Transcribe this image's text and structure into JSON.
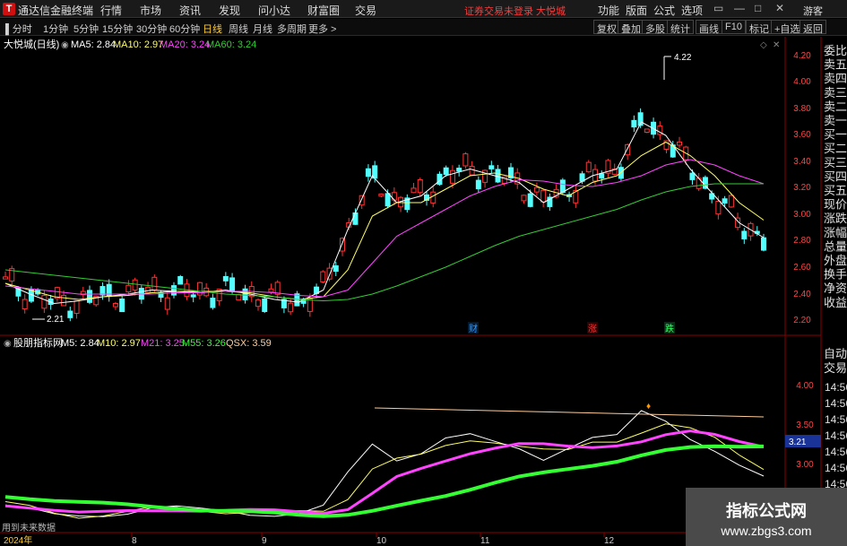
{
  "app": {
    "title": "通达信金融终端",
    "menu": [
      "行情",
      "市场",
      "资讯",
      "发现",
      "问小达",
      "财富圈",
      "交易"
    ],
    "notice": "证券交易未登录  大悦城",
    "right_menu": [
      "功能",
      "版面",
      "公式",
      "选项"
    ],
    "guest": "游客"
  },
  "toolbar": {
    "periods": [
      "分时",
      "1分钟",
      "5分钟",
      "15分钟",
      "30分钟",
      "60分钟",
      "日线",
      "周线",
      "月线",
      "多周期",
      "更多 >"
    ],
    "active_period": "日线",
    "buttons": [
      "复权",
      "叠加",
      "多股",
      "统计",
      "画线",
      "F10",
      "标记",
      "+自选",
      "返回"
    ]
  },
  "main_chart": {
    "stock_label": "大悦城(日线)",
    "ma_legend": [
      {
        "label": "MA5: 2.84",
        "color": "#ffffff"
      },
      {
        "label": "MA10: 2.97",
        "color": "#ffff66"
      },
      {
        "label": "MA20: 3.24",
        "color": "#ff44ff"
      },
      {
        "label": "MA60: 3.24",
        "color": "#33cc33"
      }
    ],
    "price_axis": [
      "4.20",
      "4.00",
      "3.80",
      "3.60",
      "3.40",
      "3.20",
      "3.00",
      "2.80",
      "2.60",
      "2.40",
      "2.20"
    ],
    "high_label": "4.22",
    "low_label": "2.21",
    "event_markers": [
      {
        "label": "财",
        "color": "#3399ff"
      },
      {
        "label": "涨",
        "color": "#ff3333"
      },
      {
        "label": "跌",
        "color": "#33ff66"
      }
    ]
  },
  "side_panel": {
    "labels": [
      "委比",
      "卖五",
      "卖四",
      "卖三",
      "卖二",
      "卖一",
      "买一",
      "买二",
      "买三",
      "买四",
      "买五",
      "现价",
      "涨跌",
      "涨幅",
      "总量",
      "外盘",
      "换手",
      "净资",
      "收益"
    ],
    "lower_labels": [
      "自动",
      "交易"
    ],
    "times": [
      "14:56",
      "14:56",
      "14:56",
      "14:56",
      "14:56",
      "14:56",
      "14:56",
      "14:56"
    ]
  },
  "indicator": {
    "name": "股朋指标网",
    "legend": [
      {
        "label": "M5: 2.84",
        "color": "#ffffff"
      },
      {
        "label": "M10: 2.97",
        "color": "#ffff66"
      },
      {
        "label": "M21: 3.25",
        "color": "#ff44ff"
      },
      {
        "label": "M55: 3.26",
        "color": "#33ff33"
      },
      {
        "label": "QSX: 3.59",
        "color": "#ffcc99"
      }
    ],
    "axis": [
      "4.00",
      "3.50",
      "3.00"
    ],
    "current_value": "3.21",
    "footnote": "用到未来数据"
  },
  "time_axis": [
    "2024年",
    "8",
    "9",
    "10",
    "11",
    "12"
  ],
  "watermark": {
    "title": "指标公式网",
    "url": "www.zbgs3.com"
  },
  "chart_data": {
    "type": "line",
    "title": "大悦城(日线)",
    "ylim": [
      2.1,
      4.3
    ],
    "series": [
      {
        "name": "MA5",
        "values": [
          2.5,
          2.42,
          2.35,
          2.37,
          2.4,
          2.42,
          2.45,
          2.44,
          2.43,
          2.45,
          2.42,
          2.38,
          2.36,
          2.45,
          2.9,
          3.3,
          3.1,
          3.15,
          3.3,
          3.35,
          3.3,
          3.25,
          3.1,
          3.2,
          3.3,
          3.35,
          3.7,
          3.6,
          3.35,
          3.15,
          2.95,
          2.84
        ]
      },
      {
        "name": "MA10",
        "values": [
          2.5,
          2.45,
          2.4,
          2.38,
          2.4,
          2.41,
          2.43,
          2.44,
          2.44,
          2.44,
          2.43,
          2.4,
          2.38,
          2.4,
          2.6,
          3.0,
          3.1,
          3.1,
          3.2,
          3.3,
          3.32,
          3.28,
          3.2,
          3.15,
          3.25,
          3.3,
          3.45,
          3.55,
          3.45,
          3.3,
          3.1,
          2.97
        ]
      },
      {
        "name": "MA20",
        "values": [
          2.48,
          2.46,
          2.44,
          2.42,
          2.42,
          2.42,
          2.42,
          2.43,
          2.43,
          2.44,
          2.44,
          2.43,
          2.41,
          2.4,
          2.45,
          2.65,
          2.85,
          2.95,
          3.05,
          3.15,
          3.22,
          3.27,
          3.26,
          3.23,
          3.22,
          3.25,
          3.3,
          3.38,
          3.42,
          3.38,
          3.3,
          3.24
        ]
      },
      {
        "name": "MA60",
        "values": [
          2.6,
          2.58,
          2.56,
          2.54,
          2.52,
          2.5,
          2.48,
          2.46,
          2.44,
          2.42,
          2.41,
          2.4,
          2.38,
          2.37,
          2.38,
          2.42,
          2.48,
          2.55,
          2.62,
          2.7,
          2.78,
          2.85,
          2.9,
          2.95,
          3.0,
          3.05,
          3.12,
          3.18,
          3.22,
          3.24,
          3.24,
          3.24
        ]
      }
    ]
  }
}
